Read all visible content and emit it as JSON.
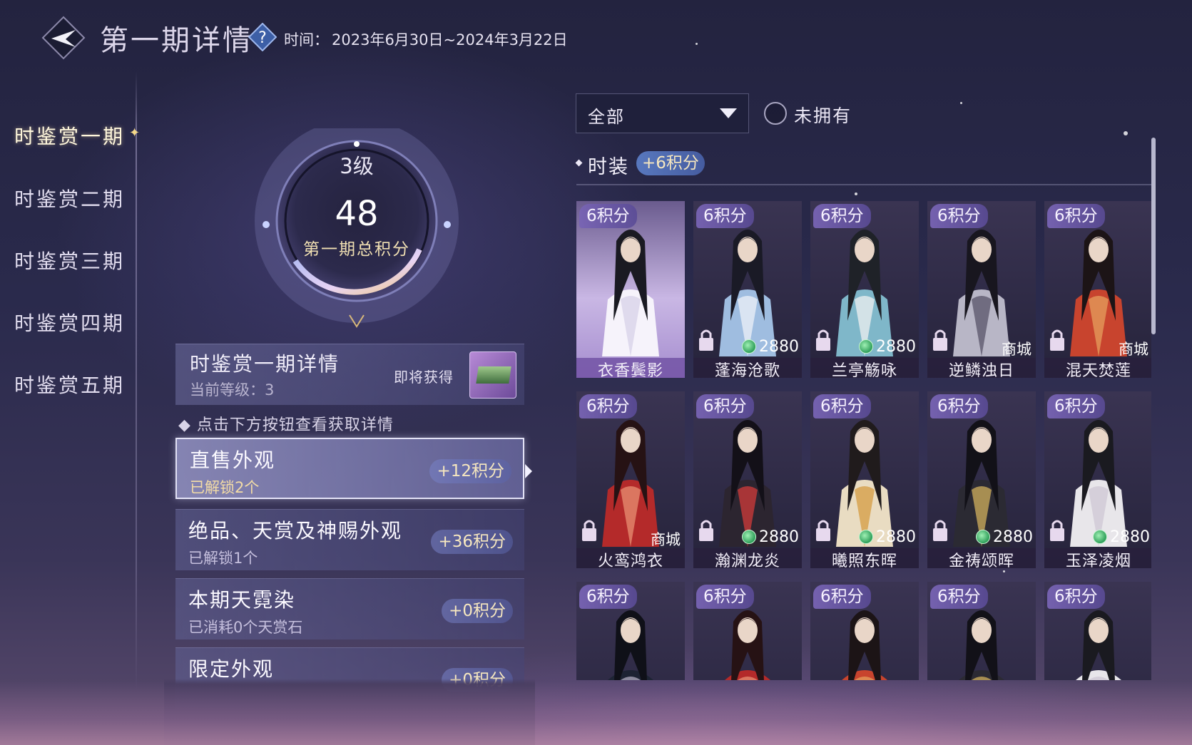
{
  "header": {
    "title": "第一期详情",
    "time_label": "时间：",
    "time_range": "2023年6月30日~2024年3月22日"
  },
  "sidebar": {
    "items": [
      {
        "label": "时鉴赏一期",
        "active": true
      },
      {
        "label": "时鉴赏二期",
        "active": false
      },
      {
        "label": "时鉴赏三期",
        "active": false
      },
      {
        "label": "时鉴赏四期",
        "active": false
      },
      {
        "label": "时鉴赏五期",
        "active": false
      }
    ]
  },
  "score": {
    "level": "3级",
    "total": "48",
    "caption": "第一期总积分"
  },
  "detail": {
    "title": "时鉴赏一期详情",
    "current_level": "当前等级：3",
    "upcoming_label": "即将获得",
    "hint": "点击下方按钮查看获取详情"
  },
  "categories": [
    {
      "name": "直售外观",
      "sub": "已解锁2个",
      "points": "+12积分",
      "selected": true
    },
    {
      "name": "绝品、天赏及神赐外观",
      "sub": "已解锁1个",
      "points": "+36积分",
      "selected": false
    },
    {
      "name": "本期天霓染",
      "sub": "已消耗0个天赏石",
      "points": "+0积分",
      "selected": false
    },
    {
      "name": "限定外观",
      "sub": "",
      "points": "+0积分",
      "selected": false
    }
  ],
  "filter": {
    "selected": "全部",
    "unowned_label": "未拥有"
  },
  "section": {
    "title": "时装",
    "points": "+6积分"
  },
  "outfits": [
    {
      "tag": "6积分",
      "name": "衣香鬓影",
      "price": "",
      "shop": "",
      "locked": false,
      "featured": true,
      "palette": "white"
    },
    {
      "tag": "6积分",
      "name": "蓬海沧歌",
      "price": "2880",
      "shop": "",
      "locked": true,
      "featured": false,
      "palette": "blue"
    },
    {
      "tag": "6积分",
      "name": "兰亭觞咏",
      "price": "2880",
      "shop": "",
      "locked": true,
      "featured": false,
      "palette": "teal"
    },
    {
      "tag": "6积分",
      "name": "逆鳞浊日",
      "price": "",
      "shop": "商城",
      "locked": true,
      "featured": false,
      "palette": "silver"
    },
    {
      "tag": "6积分",
      "name": "混天焚莲",
      "price": "",
      "shop": "商城",
      "locked": true,
      "featured": false,
      "palette": "red"
    },
    {
      "tag": "6积分",
      "name": "火鸾鸿衣",
      "price": "",
      "shop": "商城",
      "locked": true,
      "featured": false,
      "palette": "crimson"
    },
    {
      "tag": "6积分",
      "name": "瀚渊龙炎",
      "price": "2880",
      "shop": "",
      "locked": true,
      "featured": false,
      "palette": "dark"
    },
    {
      "tag": "6积分",
      "name": "曦照东晖",
      "price": "2880",
      "shop": "",
      "locked": true,
      "featured": false,
      "palette": "gold"
    },
    {
      "tag": "6积分",
      "name": "金祷颂晖",
      "price": "2880",
      "shop": "",
      "locked": true,
      "featured": false,
      "palette": "black"
    },
    {
      "tag": "6积分",
      "name": "玉泽凌烟",
      "price": "2880",
      "shop": "",
      "locked": true,
      "featured": false,
      "palette": "ivory"
    },
    {
      "tag": "6积分",
      "name": "",
      "price": "",
      "shop": "",
      "locked": false,
      "featured": false,
      "palette": "navy"
    },
    {
      "tag": "6积分",
      "name": "",
      "price": "",
      "shop": "",
      "locked": false,
      "featured": false,
      "palette": "crimson"
    },
    {
      "tag": "6积分",
      "name": "",
      "price": "",
      "shop": "",
      "locked": false,
      "featured": false,
      "palette": "red"
    },
    {
      "tag": "6积分",
      "name": "",
      "price": "",
      "shop": "",
      "locked": false,
      "featured": false,
      "palette": "black"
    },
    {
      "tag": "6积分",
      "name": "",
      "price": "",
      "shop": "",
      "locked": false,
      "featured": false,
      "palette": "ivory"
    }
  ],
  "colors": {
    "accent_gold": "#f1e0b3",
    "coin_green": "#2e9e59",
    "points_tag": "#7864b4"
  }
}
